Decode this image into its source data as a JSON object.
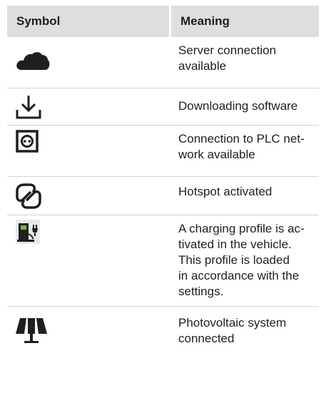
{
  "header": {
    "symbol": "Symbol",
    "meaning": "Meaning"
  },
  "rows": [
    {
      "icon": "cloud-icon",
      "lines": [
        "Server connection",
        "available"
      ]
    },
    {
      "icon": "download-icon",
      "lines": [
        "Downloading software"
      ]
    },
    {
      "icon": "plc-network-icon",
      "lines": [
        "Connection to PLC net-",
        "work available"
      ]
    },
    {
      "icon": "hotspot-link-icon",
      "lines": [
        "Hotspot activated"
      ]
    },
    {
      "icon": "charging-profile-icon",
      "lines": [
        "A charging profile is ac-",
        "tivated in the vehicle.",
        "This profile is loaded",
        "in accordance with the",
        "settings."
      ]
    },
    {
      "icon": "solar-panel-icon",
      "lines": [
        "Photovoltaic system",
        "connected"
      ]
    }
  ]
}
